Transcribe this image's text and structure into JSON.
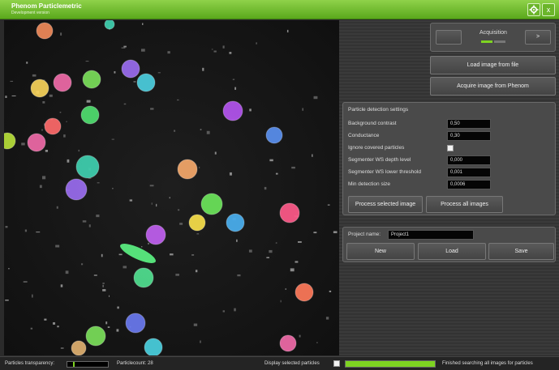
{
  "app": {
    "title": "Phenom Particlemetric",
    "subtitle": "Development version",
    "settings_icon": "gear-icon",
    "close_label": "x"
  },
  "acquisition": {
    "title": "Acquisition",
    "prev_label": "",
    "next_label": ">",
    "active_color": "#7ed321"
  },
  "actions": {
    "load_image": "Load image from file",
    "acquire_image": "Acquire image from Phenom"
  },
  "detection": {
    "title": "Particle detection settings",
    "rows": [
      {
        "label": "Background contrast",
        "value": "0,50"
      },
      {
        "label": "Conductance",
        "value": "0,30"
      },
      {
        "label": "Ignore covered particles",
        "checked": true
      },
      {
        "label": "Segmenter WS depth level",
        "value": "0,000"
      },
      {
        "label": "Segmenter WS lower threshold",
        "value": "0,001"
      },
      {
        "label": "Min detection size",
        "value": "0,0006"
      }
    ],
    "process_selected": "Process selected image",
    "process_all": "Process all images"
  },
  "project": {
    "name_label": "Project name:",
    "name_value": "Project1",
    "new_label": "New",
    "load_label": "Load",
    "save_label": "Save"
  },
  "status": {
    "transparency_label": "Particles transparency:",
    "transparency_level": 0.15,
    "particle_count_text": "Particlecount: 28",
    "display_selected_label": "Display selected particles",
    "progress": 1.0,
    "progress_color": "#7ed321",
    "status_message": "Finished searching all images for particles"
  },
  "particles": [
    {
      "color": "#f08a5a"
    },
    {
      "color": "#3fd0b0"
    },
    {
      "color": "#f7d25a"
    },
    {
      "color": "#f06aa8"
    },
    {
      "color": "#7be05a"
    },
    {
      "color": "#9a6cf0"
    },
    {
      "color": "#4ccfe0"
    },
    {
      "color": "#50e070"
    },
    {
      "color": "#ff6a6a"
    },
    {
      "color": "#f06aa8"
    },
    {
      "color": "#b7e03a"
    },
    {
      "color": "#b455f0"
    },
    {
      "color": "#5a90f0"
    },
    {
      "color": "#3fd0b0"
    },
    {
      "color": "#f5a86a"
    },
    {
      "color": "#9a6cf0"
    },
    {
      "color": "#6be55a"
    },
    {
      "color": "#f7e04a"
    },
    {
      "color": "#4ab0f0"
    },
    {
      "color": "#ff5a8a"
    },
    {
      "color": "#c060f0"
    },
    {
      "color": "#50e090"
    },
    {
      "color": "#ff7a5a"
    },
    {
      "color": "#6a7af0"
    },
    {
      "color": "#7be05a"
    },
    {
      "color": "#4ad0e0"
    },
    {
      "color": "#f06aa8"
    },
    {
      "color": "#e0b070"
    }
  ]
}
